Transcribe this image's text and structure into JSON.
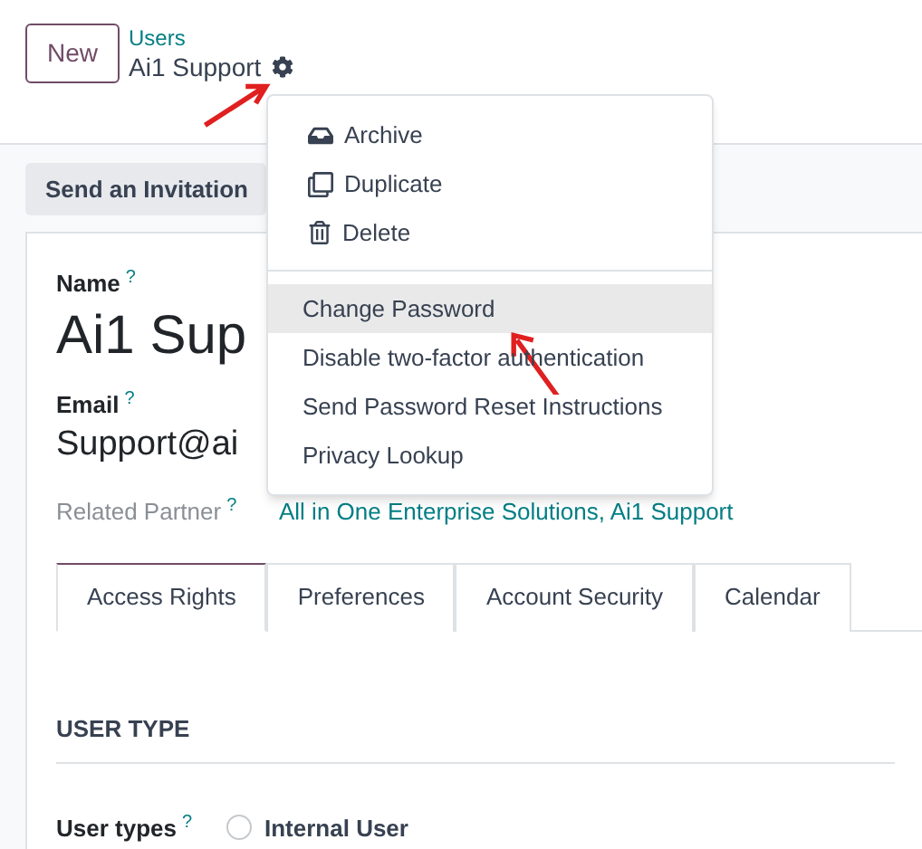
{
  "header": {
    "new_button": "New",
    "breadcrumb": "Users",
    "record_title": "Ai1 Support"
  },
  "action_button": "Send an Invitation",
  "form": {
    "name": {
      "label": "Name",
      "help": "?",
      "value": "Ai1 Sup"
    },
    "email": {
      "label": "Email",
      "help": "?",
      "value": "Support@ai"
    },
    "related_partner": {
      "label": "Related Partner",
      "help": "?",
      "value": "All in One Enterprise Solutions, Ai1 Support"
    },
    "tabs": [
      {
        "label": "Access Rights",
        "selected": true
      },
      {
        "label": "Preferences",
        "selected": false
      },
      {
        "label": "Account Security",
        "selected": false
      },
      {
        "label": "Calendar",
        "selected": false
      }
    ],
    "section_title": "USER TYPE",
    "user_types": {
      "label": "User types",
      "help": "?",
      "option": "Internal User",
      "checked": false
    }
  },
  "menu": {
    "items": [
      {
        "kind": "icon",
        "label": "Archive",
        "selected": false
      },
      {
        "kind": "icon",
        "label": "Duplicate",
        "selected": false
      },
      {
        "kind": "icon",
        "label": "Delete",
        "selected": false
      },
      {
        "kind": "divider"
      },
      {
        "kind": "plain",
        "label": "Change Password",
        "selected": true
      },
      {
        "kind": "plain",
        "label": "Disable two-factor authentication",
        "selected": false
      },
      {
        "kind": "plain",
        "label": "Send Password Reset Instructions",
        "selected": false
      },
      {
        "kind": "plain",
        "label": "Privacy Lookup",
        "selected": false
      }
    ]
  }
}
